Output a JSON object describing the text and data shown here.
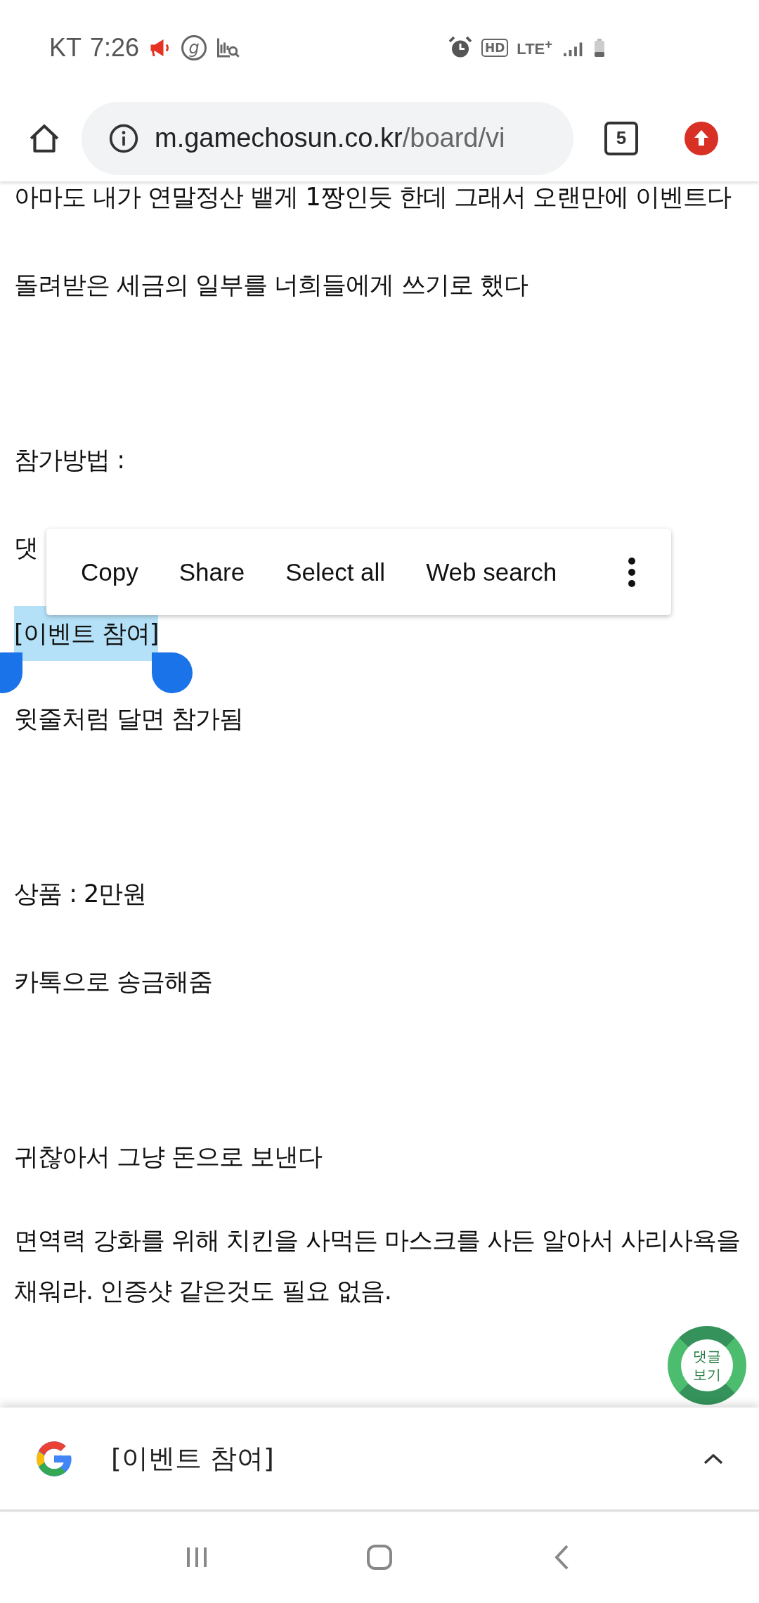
{
  "status_bar": {
    "carrier": "KT",
    "time": "7:26",
    "g_badge": "g",
    "hd_badge": "HD",
    "network": "LTE$^{+}$"
  },
  "toolbar": {
    "url_host": "m.gamechosun.co.kr",
    "url_path": "/board/vi",
    "tab_count": "5"
  },
  "article": {
    "paragraphs": [
      {
        "kind": "text",
        "text": "아마도 내가 연말정산 뱉게 1짱인듯 한데 그래서 오랜만에 이벤트다",
        "selected": false
      },
      {
        "kind": "text",
        "text": "돌려받은 세금의 일부를 너희들에게 쓰기로 했다",
        "selected": false
      },
      {
        "kind": "blank"
      },
      {
        "kind": "text",
        "text": "참가방법 :",
        "selected": false
      },
      {
        "kind": "text",
        "text": "댓",
        "selected": false
      },
      {
        "kind": "text",
        "text": "[이벤트 참여]",
        "selected": true
      },
      {
        "kind": "text",
        "text": "윗줄처럼 달면 참가됨",
        "selected": false
      },
      {
        "kind": "blank"
      },
      {
        "kind": "text",
        "text": "상품 : 2만원",
        "selected": false
      },
      {
        "kind": "text",
        "text": "카톡으로 송금해줌",
        "selected": false
      },
      {
        "kind": "blank"
      },
      {
        "kind": "text",
        "text": "귀찮아서 그냥 돈으로 보낸다",
        "selected": false
      },
      {
        "kind": "text",
        "text": "면역력 강화를 위해 치킨을 사먹든 마스크를 사든 알아서 사리사욕을 채워라. 인증샷 같은것도 필요 없음.",
        "selected": false
      }
    ]
  },
  "selection_menu": {
    "items": [
      "Copy",
      "Share",
      "Select all",
      "Web search"
    ]
  },
  "comment_button": {
    "label": "댓글 보기"
  },
  "search_sheet": {
    "query": "[이벤트 참여]"
  }
}
